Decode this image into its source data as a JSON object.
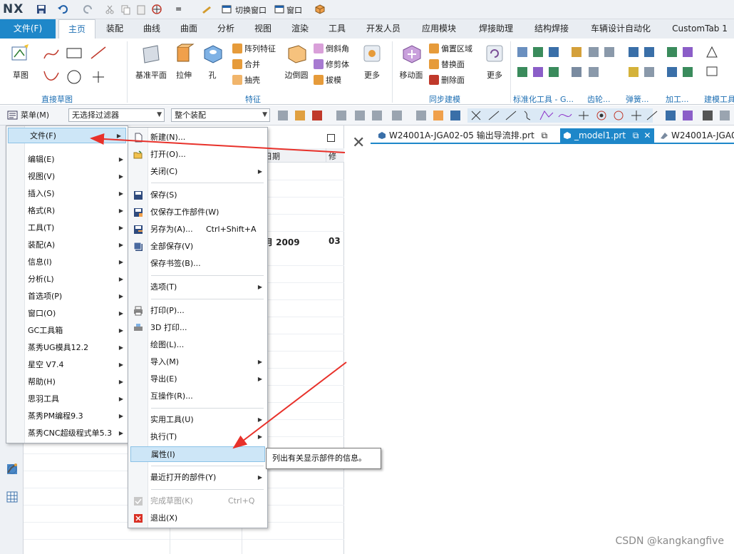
{
  "quick_access": {
    "logo": "NX",
    "switch_window_label": "切换窗口",
    "window_label": "窗口"
  },
  "tabs": {
    "file": "文件(F)",
    "items": [
      "主页",
      "装配",
      "曲线",
      "曲面",
      "分析",
      "视图",
      "渲染",
      "工具",
      "开发人员",
      "应用模块",
      "焊接助理",
      "结构焊接",
      "车辆设计自动化",
      "CustomTab 1"
    ],
    "active": "主页"
  },
  "ribbon": {
    "sketch": "草图",
    "direct_sketch_group": "直接草图",
    "datum_plane": "基准平面",
    "extrude": "拉伸",
    "hole": "孔",
    "pattern_feature": "阵列特征",
    "unite": "合并",
    "shell": "抽壳",
    "edge_blend": "边倒圆",
    "chamfer": "倒斜角",
    "trim_body": "修剪体",
    "draft": "拔模",
    "more1": "更多",
    "feature_group": "特征",
    "move_face": "移动面",
    "offset_region": "偏置区域",
    "replace_face": "替换面",
    "delete_face": "删除面",
    "more2": "更多",
    "sync_group": "同步建模",
    "std_tools_group": "标准化工具 - G...",
    "gear_group": "齿轮...",
    "spring_group": "弹簧...",
    "machining_group": "加工...",
    "building_group": "建模工具"
  },
  "selbar": {
    "menu_button": "菜单(M)",
    "filter": "无选择过滤器",
    "scope": "整个装配"
  },
  "navigator": {
    "date_col": "日期",
    "mod_col": "修",
    "row_date": "月 2009",
    "row_mod": "03"
  },
  "doc_tabs": [
    {
      "label": "W24001A-JGA02-05 输出导流排.prt",
      "active": false
    },
    {
      "label": "_model1.prt",
      "active": true
    },
    {
      "label": "W24001A-JGA0",
      "active": false
    }
  ],
  "main_menu": [
    {
      "label": "文件(F)",
      "highlight": true
    },
    {
      "label": "编辑(E)"
    },
    {
      "label": "视图(V)"
    },
    {
      "label": "插入(S)"
    },
    {
      "label": "格式(R)"
    },
    {
      "label": "工具(T)"
    },
    {
      "label": "装配(A)"
    },
    {
      "label": "信息(I)"
    },
    {
      "label": "分析(L)"
    },
    {
      "label": "首选项(P)"
    },
    {
      "label": "窗口(O)"
    },
    {
      "label": "GC工具箱"
    },
    {
      "label": "蒸秀UG模具12.2"
    },
    {
      "label": "星空 V7.4"
    },
    {
      "label": "帮助(H)"
    },
    {
      "label": "思羽工具"
    },
    {
      "label": "蒸秀PM编程9.3"
    },
    {
      "label": "蒸秀CNC超级程式单5.3"
    }
  ],
  "file_menu": [
    {
      "label": "新建(N)...",
      "icon": "new-icon"
    },
    {
      "label": "打开(O)...",
      "icon": "open-icon"
    },
    {
      "label": "关闭(C)",
      "submenu": true
    },
    {
      "label": "保存(S)",
      "icon": "save-icon"
    },
    {
      "label": "仅保存工作部件(W)",
      "icon": "save-work-part-icon"
    },
    {
      "label": "另存为(A)...",
      "icon": "save-as-icon",
      "shortcut": "Ctrl+Shift+A"
    },
    {
      "label": "全部保存(V)",
      "icon": "save-all-icon"
    },
    {
      "label": "保存书签(B)..."
    },
    {
      "label": "选项(T)",
      "submenu": true
    },
    {
      "label": "打印(P)...",
      "icon": "print-icon"
    },
    {
      "label": "3D 打印...",
      "icon": "3d-print-icon"
    },
    {
      "label": "绘图(L)..."
    },
    {
      "label": "导入(M)",
      "submenu": true
    },
    {
      "label": "导出(E)",
      "submenu": true
    },
    {
      "label": "互操作(R)..."
    },
    {
      "label": "实用工具(U)",
      "submenu": true
    },
    {
      "label": "执行(T)",
      "submenu": true
    },
    {
      "label": "属性(I)",
      "highlight": true
    },
    {
      "label": "最近打开的部件(Y)",
      "submenu": true
    },
    {
      "label": "完成草图(K)",
      "icon": "finish-sketch-icon",
      "shortcut": "Ctrl+Q",
      "disabled": true
    },
    {
      "label": "退出(X)",
      "icon": "exit-icon"
    }
  ],
  "tooltip": "列出有关显示部件的信息。",
  "watermark": "CSDN @kangkangfive",
  "colors": {
    "accent": "#1e87c9",
    "highlight": "#cde6f7",
    "annotation_arrow": "#e8312a"
  }
}
